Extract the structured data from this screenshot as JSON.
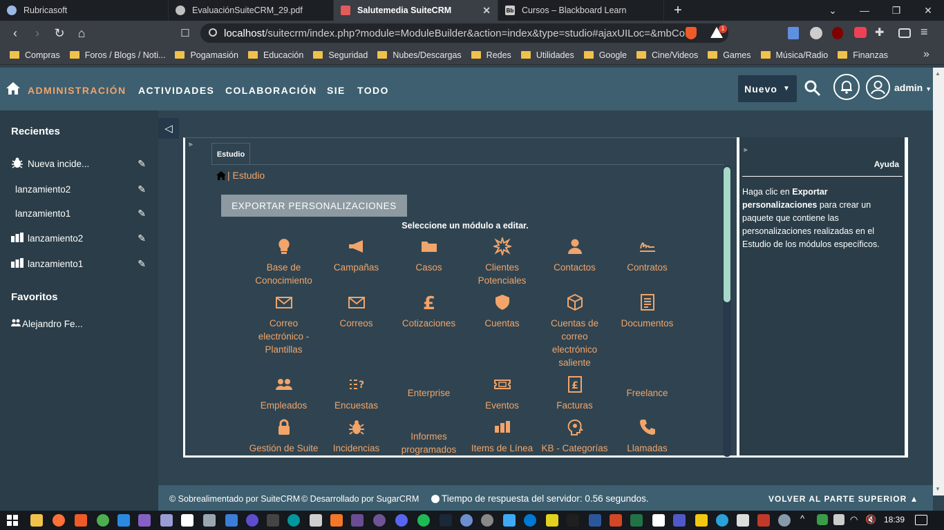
{
  "browser": {
    "tabs": [
      {
        "title": "Rubricasoft",
        "icon_color": "#9ab8e6"
      },
      {
        "title": "EvaluaciónSuiteCRM_29.pdf",
        "icon_color": "#bfbfbf"
      },
      {
        "title": "Salutemedia SuiteCRM",
        "icon_color": "#e35b5b"
      },
      {
        "title": "Cursos – Blackboard Learn",
        "icon_color": "#cccccc",
        "icon_text": "Bb"
      }
    ],
    "new_tab": "+",
    "url_host": "localhost",
    "url_rest": "/suitecrm/index.php?module=ModuleBuilder&action=index&type=studio#ajaxUILoc=&mbCo...",
    "brave_badge": "1",
    "bookmarks": [
      "Compras",
      "Foros / Blogs / Noti...",
      "Pogamasión",
      "Educación",
      "Seguridad",
      "Nubes/Descargas",
      "Redes",
      "Utilidades",
      "Google",
      "Cine/Videos",
      "Games",
      "Música/Radio",
      "Finanzas"
    ],
    "bookmarks_more": "»"
  },
  "topnav": {
    "items": [
      "ADMINISTRACIÓN",
      "ACTIVIDADES",
      "COLABORACIÓN",
      "SIE",
      "TODO"
    ],
    "active_color": "#f2a46b",
    "nuevo": "Nuevo",
    "user": "admin"
  },
  "sidebar": {
    "recent_heading": "Recientes",
    "recent": [
      {
        "label": "Nueva incide...",
        "icon": "bug-icon"
      },
      {
        "label": "lanzamiento2",
        "icon": ""
      },
      {
        "label": "lanzamiento1",
        "icon": ""
      },
      {
        "label": "lanzamiento2",
        "icon": "bars-icon"
      },
      {
        "label": "lanzamiento1",
        "icon": "bars-icon"
      }
    ],
    "favorites_heading": "Favoritos",
    "favorites": [
      {
        "label": "Alejandro Fe...",
        "icon": "users-icon"
      }
    ]
  },
  "studio": {
    "tab_label": "Estudio",
    "breadcrumb": "| Estudio",
    "export_button": "EXPORTAR PERSONALIZACIONES",
    "select_prompt": "Seleccione un módulo a editar.",
    "modules": [
      {
        "label": "Base de Conocimiento",
        "icon": "lightbulb-icon"
      },
      {
        "label": "Campañas",
        "icon": "megaphone-icon"
      },
      {
        "label": "Casos",
        "icon": "folder-icon"
      },
      {
        "label": "Clientes Potenciales",
        "icon": "starburst-icon"
      },
      {
        "label": "Contactos",
        "icon": "person-icon"
      },
      {
        "label": "Contratos",
        "icon": "signature-icon"
      },
      {
        "label": "Correo electrónico - Plantillas",
        "icon": "envelope-icon"
      },
      {
        "label": "Correos",
        "icon": "envelope-icon"
      },
      {
        "label": "Cotizaciones",
        "icon": "pound-icon"
      },
      {
        "label": "Cuentas",
        "icon": "shield-icon"
      },
      {
        "label": "Cuentas de correo electrónico saliente",
        "icon": "cube-icon"
      },
      {
        "label": "Documentos",
        "icon": "document-icon"
      },
      {
        "label": "Empleados",
        "icon": "people-icon"
      },
      {
        "label": "Encuestas",
        "icon": "survey-icon"
      },
      {
        "label": "Enterprise",
        "icon": ""
      },
      {
        "label": "Eventos",
        "icon": "ticket-icon"
      },
      {
        "label": "Facturas",
        "icon": "invoice-icon"
      },
      {
        "label": "Freelance",
        "icon": ""
      },
      {
        "label": "Gestión de Suite de Seguridad",
        "icon": "lock-icon"
      },
      {
        "label": "Incidencias",
        "icon": "bug-icon"
      },
      {
        "label": "Informes programados",
        "icon": ""
      },
      {
        "label": "Items de Línea",
        "icon": "bars-icon"
      },
      {
        "label": "KB - Categorías",
        "icon": "head-icon"
      },
      {
        "label": "Llamadas",
        "icon": "phone-icon"
      }
    ]
  },
  "help": {
    "heading": "Ayuda",
    "text_before": "Haga clic en ",
    "text_bold": "Exportar personalizaciones",
    "text_after": " para crear un paquete que contiene las personalizaciones realizadas en el Estudio de los módulos específicos."
  },
  "footer": {
    "powered": "© Sobrealimentado por SuiteCRM",
    "developed": "© Desarrollado por SugarCRM",
    "response": "Tiempo de respuesta del servidor: 0.56 segundos.",
    "back_top": "VOLVER AL PARTE SUPERIOR"
  },
  "taskbar": {
    "time": "18:39"
  }
}
